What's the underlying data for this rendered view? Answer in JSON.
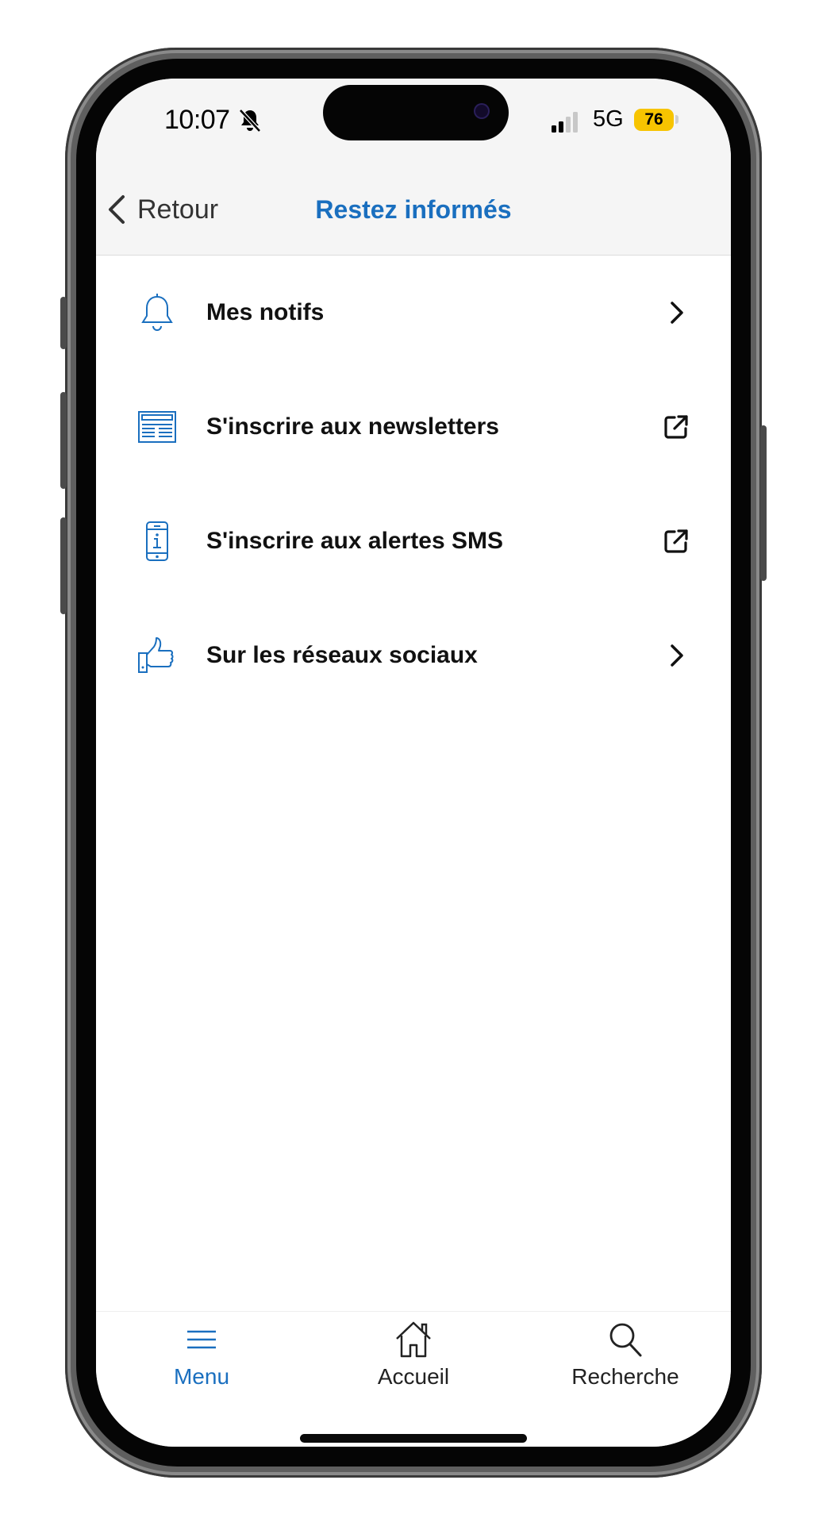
{
  "status_bar": {
    "time": "10:07",
    "network": "5G",
    "battery": "76",
    "battery_color": "#f7c400"
  },
  "header": {
    "back_label": "Retour",
    "title": "Restez informés",
    "accent_color": "#1a6fbf"
  },
  "menu": {
    "items": [
      {
        "label": "Mes notifs",
        "icon": "bell-icon",
        "trail": "chevron-right-icon"
      },
      {
        "label": "S'inscrire aux newsletters",
        "icon": "newsletter-icon",
        "trail": "external-link-icon"
      },
      {
        "label": "S'inscrire aux alertes SMS",
        "icon": "phone-info-icon",
        "trail": "external-link-icon"
      },
      {
        "label": "Sur les réseaux sociaux",
        "icon": "thumbs-up-icon",
        "trail": "chevron-right-icon"
      }
    ]
  },
  "tab_bar": {
    "tabs": [
      {
        "label": "Menu",
        "icon": "hamburger-menu-icon",
        "active": true
      },
      {
        "label": "Accueil",
        "icon": "home-icon",
        "active": false
      },
      {
        "label": "Recherche",
        "icon": "search-icon",
        "active": false
      }
    ]
  }
}
